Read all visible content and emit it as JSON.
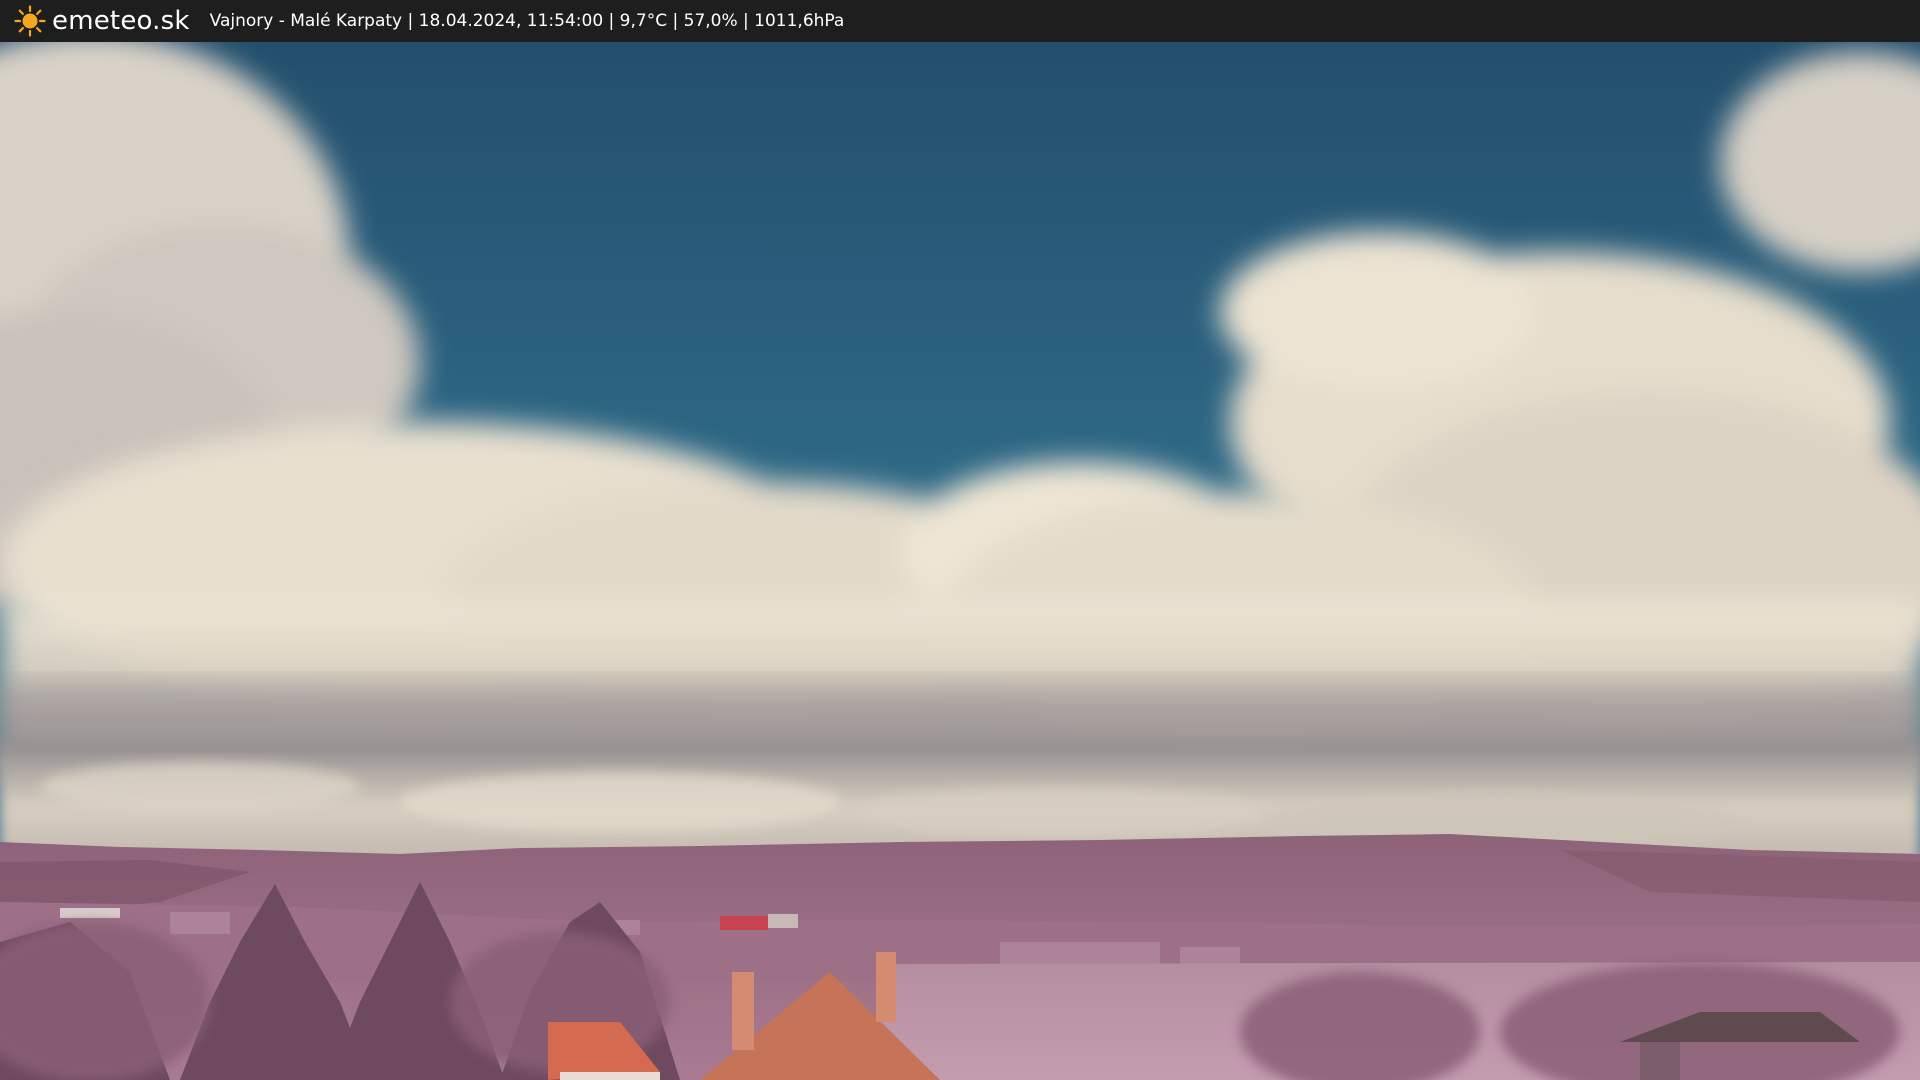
{
  "header": {
    "logo_icon": "sun-icon",
    "site_name": "emeteo.sk",
    "caption": "Vajnory - Malé Karpaty | 18.04.2024, 11:54:00 | 9,7°C | 57,0% | 1011,6hPa"
  },
  "colors": {
    "bar_background": "#1e1e1e",
    "sun": "#f5a623",
    "sky": "#2f6a86",
    "cloud": "#ece4d2",
    "foliage": "#9a6a86"
  }
}
